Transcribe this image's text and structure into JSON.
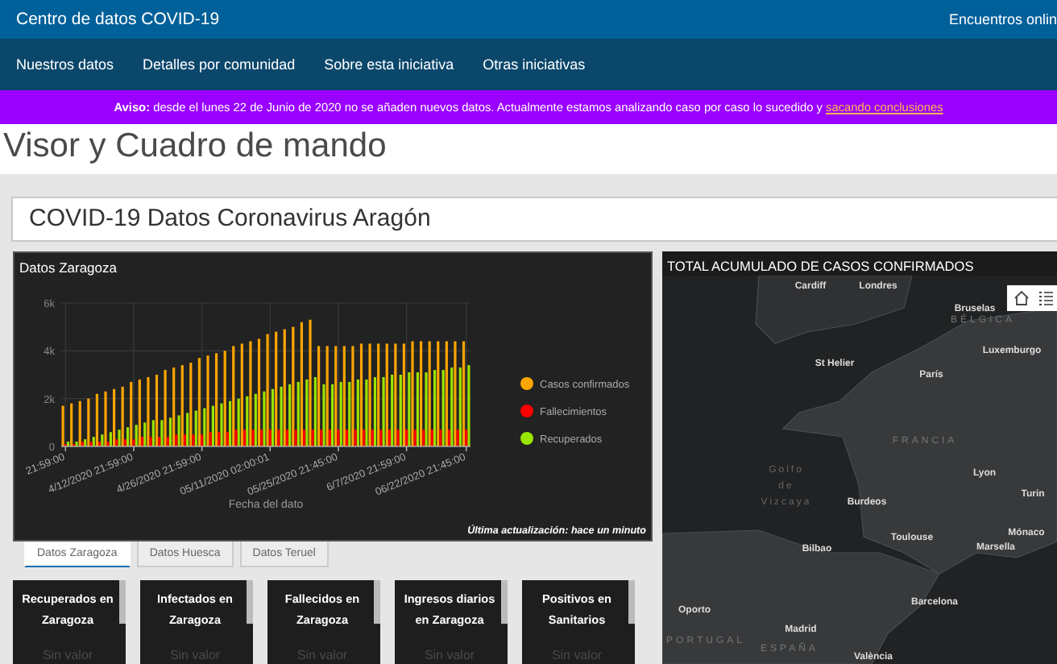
{
  "header": {
    "title": "Centro de datos COVID-19",
    "right_link": "Encuentros onlin"
  },
  "nav": [
    "Nuestros datos",
    "Detalles por comunidad",
    "Sobre esta iniciativa",
    "Otras iniciativas"
  ],
  "notice": {
    "text": "**Aviso:** desde el lunes 22 de Junio de 2020 no se añaden nuevos datos. Actualmente estamos analizando caso por caso lo sucedido y",
    "link": "sacando conclusiones"
  },
  "page_title": "Visor y Cuadro de mando",
  "dashboard_title": "COVID-19 Datos Coronavirus Aragón",
  "chart_panel": {
    "title": "Datos Zaragoza",
    "footer": "Última actualización: hace un minuto",
    "chart_data": {
      "type": "bar",
      "xlabel": "Fecha del dato",
      "grid": true,
      "legend": "right",
      "categories": [
        "21:59:00",
        null,
        null,
        null,
        null,
        null,
        null,
        null,
        "4/12/2020 21:59:00",
        null,
        null,
        null,
        null,
        null,
        null,
        null,
        "4/26/2020 21:59:00",
        null,
        null,
        null,
        null,
        null,
        null,
        null,
        "05/11/2020 02:00:01",
        null,
        null,
        null,
        null,
        null,
        null,
        null,
        "05/25/2020 21:45:00",
        null,
        null,
        null,
        null,
        null,
        null,
        null,
        "6/7/2020 21:59:00",
        null,
        null,
        null,
        null,
        null,
        null,
        "06/22/2020 21:45:00"
      ],
      "ylim": [
        0,
        6000
      ],
      "yticks": [
        {
          "value": 0,
          "label": "0"
        },
        {
          "value": 2000,
          "label": "2k"
        },
        {
          "value": 4000,
          "label": "4k"
        },
        {
          "value": 6000,
          "label": "6k"
        }
      ],
      "series": [
        {
          "name": "Casos confirmados",
          "color": "#ffa500",
          "values": [
            1700,
            1800,
            1900,
            2000,
            2200,
            2300,
            2400,
            2500,
            2700,
            2800,
            2900,
            3000,
            3200,
            3300,
            3400,
            3500,
            3700,
            3800,
            3900,
            4000,
            4200,
            4300,
            4400,
            4500,
            4700,
            4800,
            4900,
            5000,
            5200,
            5300,
            4200,
            4200,
            4200,
            4200,
            4200,
            4300,
            4300,
            4300,
            4300,
            4300,
            4300,
            4400,
            4400,
            4400,
            4400,
            4400,
            4400,
            4400
          ]
        },
        {
          "name": "Fallecimientos",
          "color": "#ff0000",
          "values": [
            100,
            100,
            200,
            200,
            200,
            200,
            300,
            300,
            300,
            400,
            400,
            400,
            400,
            500,
            500,
            500,
            500,
            600,
            600,
            600,
            700,
            700,
            700,
            700,
            700,
            700,
            700,
            700,
            700,
            700,
            700,
            700,
            700,
            700,
            700,
            700,
            700,
            700,
            700,
            700,
            700,
            700,
            700,
            700,
            700,
            700,
            700,
            700
          ]
        },
        {
          "name": "Recuperados",
          "color": "#99e600",
          "values": [
            200,
            200,
            300,
            400,
            500,
            600,
            700,
            800,
            900,
            1000,
            1100,
            1100,
            1200,
            1300,
            1400,
            1500,
            1600,
            1700,
            1800,
            1900,
            2000,
            2100,
            2200,
            2300,
            2400,
            2500,
            2600,
            2700,
            2800,
            2900,
            2600,
            2600,
            2700,
            2700,
            2800,
            2800,
            2900,
            2900,
            3000,
            3000,
            3100,
            3100,
            3100,
            3200,
            3200,
            3300,
            3300,
            3400
          ]
        }
      ]
    }
  },
  "tabs": [
    {
      "label": "Datos Zaragoza",
      "selected": true
    },
    {
      "label": "Datos Huesca",
      "selected": false
    },
    {
      "label": "Datos Teruel",
      "selected": false
    }
  ],
  "cards": [
    {
      "title": "Recuperados en Zaragoza",
      "value": "Sin valor"
    },
    {
      "title": "Infectados en Zaragoza",
      "value": "Sin valor"
    },
    {
      "title": "Fallecidos en Zaragoza",
      "value": "Sin valor"
    },
    {
      "title": "Ingresos diarios en Zaragoza",
      "value": "Sin valor"
    },
    {
      "title": "Positivos en Sanitarios",
      "value": "Sin valor"
    }
  ],
  "map": {
    "title": "TOTAL ACUMULADO DE CASOS CONFIRMADOS",
    "labels": [
      {
        "text": "Cardiff",
        "kind": "city"
      },
      {
        "text": "Londres",
        "kind": "city"
      },
      {
        "text": "Bruselas",
        "kind": "city"
      },
      {
        "text": "BÉLGICA",
        "kind": "country"
      },
      {
        "text": "Luxemburgo",
        "kind": "city"
      },
      {
        "text": "St Helier",
        "kind": "city"
      },
      {
        "text": "París",
        "kind": "city"
      },
      {
        "text": "FRANCIA",
        "kind": "country"
      },
      {
        "text": "Golfo de Vizcaya",
        "kind": "sea"
      },
      {
        "text": "Lyon",
        "kind": "city"
      },
      {
        "text": "Burdeos",
        "kind": "city"
      },
      {
        "text": "Toulouse",
        "kind": "city"
      },
      {
        "text": "Bilbao",
        "kind": "city"
      },
      {
        "text": "Marsella",
        "kind": "city"
      },
      {
        "text": "Turin",
        "kind": "city"
      },
      {
        "text": "Mónaco",
        "kind": "city"
      },
      {
        "text": "Barcelona",
        "kind": "city"
      },
      {
        "text": "Oporto",
        "kind": "city"
      },
      {
        "text": "Madrid",
        "kind": "city"
      },
      {
        "text": "PORTUGAL",
        "kind": "country"
      },
      {
        "text": "ESPAÑA",
        "kind": "country"
      },
      {
        "text": "València",
        "kind": "city"
      }
    ]
  }
}
